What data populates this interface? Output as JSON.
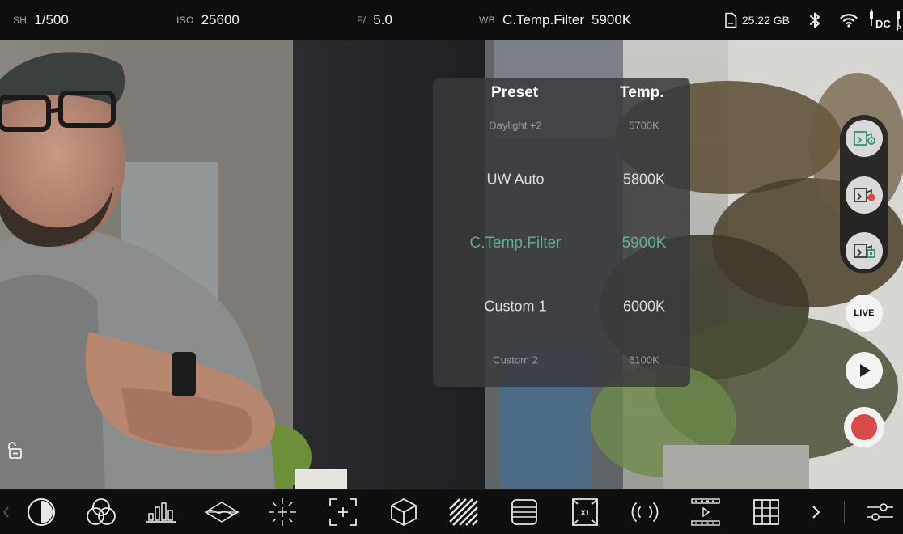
{
  "top_bar": {
    "shutter": {
      "label": "SH",
      "value": "1/500"
    },
    "iso": {
      "label": "ISO",
      "value": "25600"
    },
    "aperture": {
      "label": "F/",
      "value": "5.0"
    },
    "white_balance": {
      "label": "WB",
      "value": "C.Temp.Filter",
      "kelvin": "5900K"
    },
    "storage": {
      "icon": "sd-card-icon",
      "value": "25.22 GB"
    },
    "status_icons": [
      "bluetooth-icon",
      "wifi-icon",
      "dc-power-icon"
    ]
  },
  "wb_panel": {
    "header_preset": "Preset",
    "header_temp": "Temp.",
    "rows": [
      {
        "preset": "Daylight +2",
        "temp": "5700K",
        "state": "faded"
      },
      {
        "preset": "UW Auto",
        "temp": "5800K",
        "state": "normal"
      },
      {
        "preset": "C.Temp.Filter",
        "temp": "5900K",
        "state": "selected"
      },
      {
        "preset": "Custom 1",
        "temp": "6000K",
        "state": "normal"
      },
      {
        "preset": "Custom 2",
        "temp": "6100K",
        "state": "faded"
      }
    ]
  },
  "right_rail": {
    "buttons": [
      "camera-settings-icon",
      "camera-record-settings-icon",
      "camera-switch-icon"
    ],
    "live_label": "LIVE",
    "play": "play-icon",
    "record": "record-icon"
  },
  "left_controls": {
    "lock": "unlock-icon"
  },
  "bottom_toolbar": {
    "items": [
      "exposure-icon",
      "color-wheels-icon",
      "histogram-icon",
      "waveform-icon",
      "focus-peaking-icon",
      "focus-area-icon",
      "lut-cube-icon",
      "zebra-icon",
      "menu-lines-icon",
      "frame-guide-icon",
      "audio-icon",
      "film-strip-icon",
      "grid-icon",
      "chevron-right-icon",
      "adjust-sliders-icon"
    ]
  },
  "colors": {
    "selected": "#5fae8f",
    "record": "#d94a4a",
    "accent_green": "#3a8f6e"
  }
}
